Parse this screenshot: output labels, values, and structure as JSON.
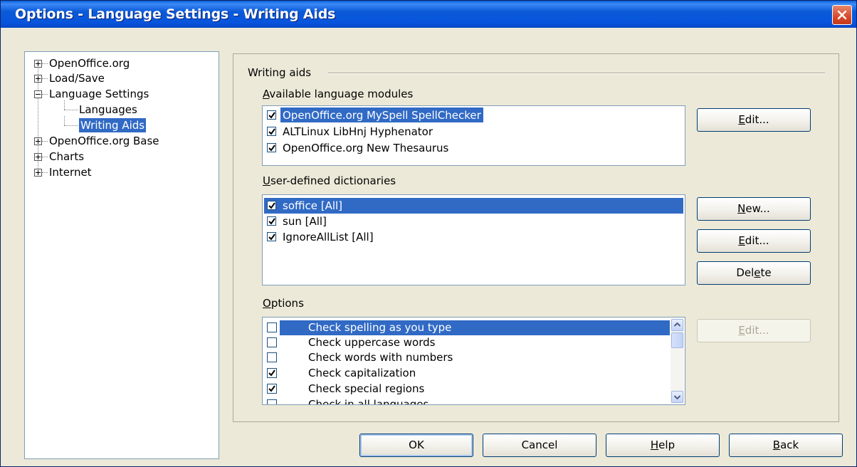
{
  "window": {
    "title": "Options - Language Settings - Writing Aids"
  },
  "tree": {
    "items": [
      {
        "label": "OpenOffice.org",
        "expander": "plus"
      },
      {
        "label": "Load/Save",
        "expander": "plus"
      },
      {
        "label": "Language Settings",
        "expander": "minus"
      },
      {
        "label": "Languages"
      },
      {
        "label": "Writing Aids",
        "selected": true
      },
      {
        "label": "OpenOffice.org Base",
        "expander": "plus"
      },
      {
        "label": "Charts",
        "expander": "plus"
      },
      {
        "label": "Internet",
        "expander": "plus"
      }
    ]
  },
  "writing_aids": {
    "group_label": "Writing aids",
    "modules": {
      "label_accel": "A",
      "label_rest": "vailable language modules",
      "items": [
        {
          "label": "OpenOffice.org MySpell SpellChecker",
          "checked": true,
          "selected": true
        },
        {
          "label": "ALTLinux LibHnj Hyphenator",
          "checked": true
        },
        {
          "label": "OpenOffice.org New Thesaurus",
          "checked": true
        }
      ],
      "edit_button": {
        "accel": "E",
        "rest": "dit..."
      }
    },
    "dictionaries": {
      "label_accel": "U",
      "label_rest": "ser-defined dictionaries",
      "items": [
        {
          "label": "soffice [All]",
          "checked": true,
          "selected": true
        },
        {
          "label": "sun [All]",
          "checked": true
        },
        {
          "label": "IgnoreAllList [All]",
          "checked": true
        }
      ],
      "new_button": {
        "accel": "N",
        "rest": "ew..."
      },
      "edit_button": {
        "accel": "E",
        "rest": "dit..."
      },
      "delete_button": {
        "pre": "Del",
        "accel": "e",
        "rest": "te"
      }
    },
    "options": {
      "label_accel": "O",
      "label_rest": "ptions",
      "items": [
        {
          "label": "Check spelling as you type",
          "checked": false,
          "selected": true
        },
        {
          "label": "Check uppercase words",
          "checked": false
        },
        {
          "label": "Check words with numbers",
          "checked": false
        },
        {
          "label": "Check capitalization",
          "checked": true
        },
        {
          "label": "Check special regions",
          "checked": true
        },
        {
          "label": "Check in all languages",
          "checked": false
        }
      ],
      "edit_button": {
        "accel": "E",
        "rest": "dit..."
      }
    }
  },
  "footer": {
    "ok": "OK",
    "cancel": "Cancel",
    "help": {
      "accel": "H",
      "rest": "elp"
    },
    "back": {
      "accel": "B",
      "rest": "ack"
    }
  },
  "colors": {
    "selection": "#316ac5",
    "titlebar": "#0a5ad8",
    "dialog_bg": "#ece9d8"
  }
}
